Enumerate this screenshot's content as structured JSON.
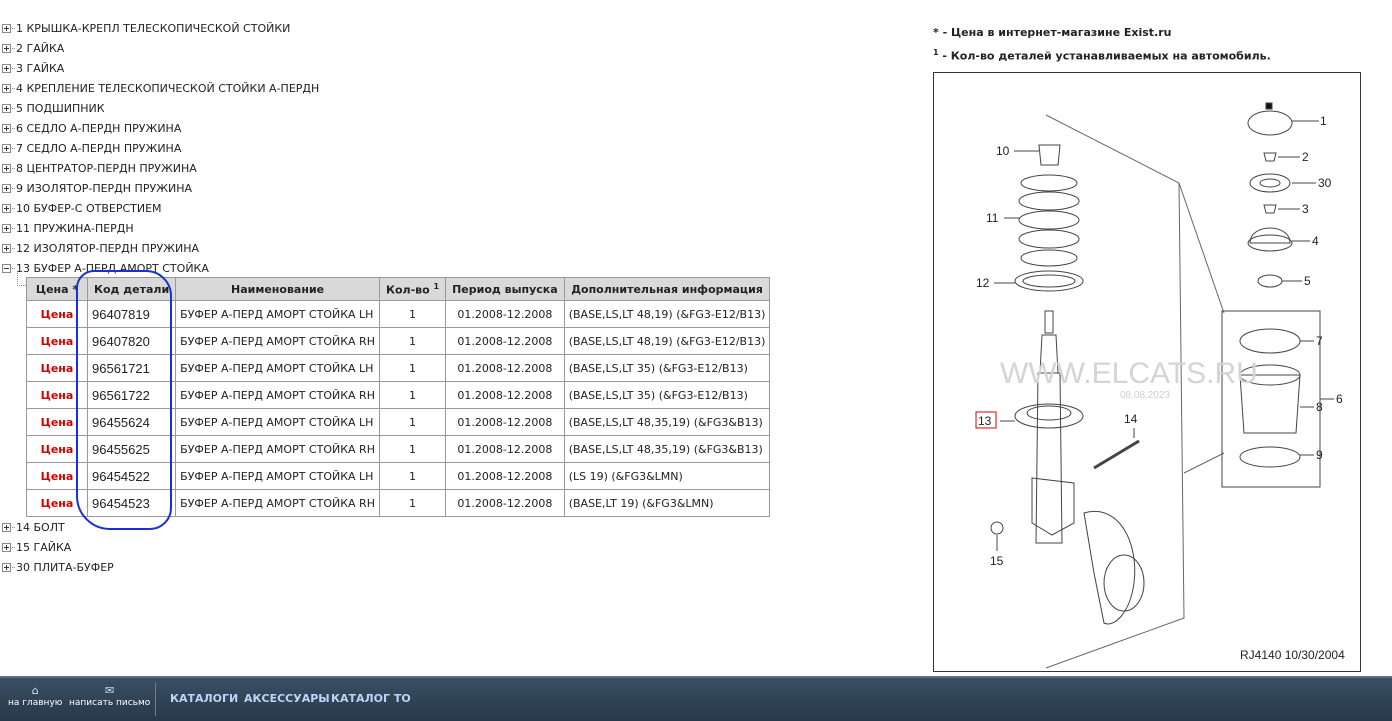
{
  "tree": [
    {
      "label": "1 КРЫШКА-КРЕПЛ ТЕЛЕСКОПИЧЕСКОЙ СТОЙКИ",
      "expanded": false
    },
    {
      "label": "2 ГАЙКА",
      "expanded": false
    },
    {
      "label": "3 ГАЙКА",
      "expanded": false
    },
    {
      "label": "4 КРЕПЛЕНИЕ ТЕЛЕСКОПИЧЕСКОЙ СТОЙКИ А-ПЕРДН",
      "expanded": false
    },
    {
      "label": "5 ПОДШИПНИК",
      "expanded": false
    },
    {
      "label": "6 СЕДЛО А-ПЕРДН ПРУЖИНА",
      "expanded": false
    },
    {
      "label": "7 СЕДЛО А-ПЕРДН ПРУЖИНА",
      "expanded": false
    },
    {
      "label": "8 ЦЕНТРАТОР-ПЕРДН ПРУЖИНА",
      "expanded": false
    },
    {
      "label": "9 ИЗОЛЯТОР-ПЕРДН ПРУЖИНА",
      "expanded": false
    },
    {
      "label": "10 БУФЕР-С ОТВЕРСТИЕМ",
      "expanded": false
    },
    {
      "label": "11 ПРУЖИНА-ПЕРДН",
      "expanded": false
    },
    {
      "label": "12 ИЗОЛЯТОР-ПЕРДН ПРУЖИНА",
      "expanded": false
    },
    {
      "label": "13 БУФЕР А-ПЕРД АМОРТ СТОЙКА",
      "expanded": true
    }
  ],
  "tree_after": [
    {
      "label": "14 БОЛТ",
      "expanded": false
    },
    {
      "label": "15 ГАЙКА",
      "expanded": false
    },
    {
      "label": "30 ПЛИТА-БУФЕР",
      "expanded": false
    }
  ],
  "table": {
    "headers": {
      "price": "Цена *",
      "code": "Код детали",
      "name": "Наименование",
      "qty": "Кол-во",
      "qty_sup": "1",
      "period": "Период выпуска",
      "info": "Дополнительная информация"
    },
    "price_label": "Цена",
    "rows": [
      {
        "code": "96407819",
        "name": "БУФЕР А-ПЕРД АМОРТ СТОЙКА LH",
        "qty": "1",
        "period": "01.2008-12.2008",
        "info": "(BASE,LS,LT 48,19) (&FG3-E12/B13)"
      },
      {
        "code": "96407820",
        "name": "БУФЕР А-ПЕРД АМОРТ СТОЙКА RH",
        "qty": "1",
        "period": "01.2008-12.2008",
        "info": "(BASE,LS,LT 48,19) (&FG3-E12/B13)"
      },
      {
        "code": "96561721",
        "name": "БУФЕР А-ПЕРД АМОРТ СТОЙКА LH",
        "qty": "1",
        "period": "01.2008-12.2008",
        "info": "(BASE,LS,LT 35) (&FG3-E12/B13)"
      },
      {
        "code": "96561722",
        "name": "БУФЕР А-ПЕРД АМОРТ СТОЙКА RH",
        "qty": "1",
        "period": "01.2008-12.2008",
        "info": "(BASE,LS,LT 35) (&FG3-E12/B13)"
      },
      {
        "code": "96455624",
        "name": "БУФЕР А-ПЕРД АМОРТ СТОЙКА LH",
        "qty": "1",
        "period": "01.2008-12.2008",
        "info": "(BASE,LS,LT 48,35,19) (&FG3&B13)"
      },
      {
        "code": "96455625",
        "name": "БУФЕР А-ПЕРД АМОРТ СТОЙКА RH",
        "qty": "1",
        "period": "01.2008-12.2008",
        "info": "(BASE,LS,LT 48,35,19) (&FG3&B13)"
      },
      {
        "code": "96454522",
        "name": "БУФЕР А-ПЕРД АМОРТ СТОЙКА LH",
        "qty": "1",
        "period": "01.2008-12.2008",
        "info": "(LS 19) (&FG3&LMN)"
      },
      {
        "code": "96454523",
        "name": "БУФЕР А-ПЕРД АМОРТ СТОЙКА RH",
        "qty": "1",
        "period": "01.2008-12.2008",
        "info": "(BASE,LT 19) (&FG3&LMN)"
      }
    ]
  },
  "notes": {
    "line1": "* - Цена в интернет-магазине Exist.ru",
    "line2_sup": "1",
    "line2": " - Кол-во деталей устанавливаемых на автомобиль."
  },
  "diagram": {
    "watermark": "WWW.ELCATS.RU",
    "date": "08.08.2023",
    "code": "RJ4140  10/30/2004",
    "callouts": [
      "1",
      "2",
      "30",
      "3",
      "4",
      "5",
      "7",
      "8",
      "6",
      "9",
      "10",
      "11",
      "12",
      "13",
      "14",
      "15"
    ]
  },
  "bottom": {
    "home_label": "на главную",
    "mail_label": "написать письмо",
    "links": [
      "КАТАЛОГИ",
      "АКСЕССУАРЫ",
      "КАТАЛОГ ТО"
    ]
  },
  "colors": {
    "price": "#d40000",
    "highlight_circle": "#1a2fd6",
    "bar": "#2f4356"
  }
}
